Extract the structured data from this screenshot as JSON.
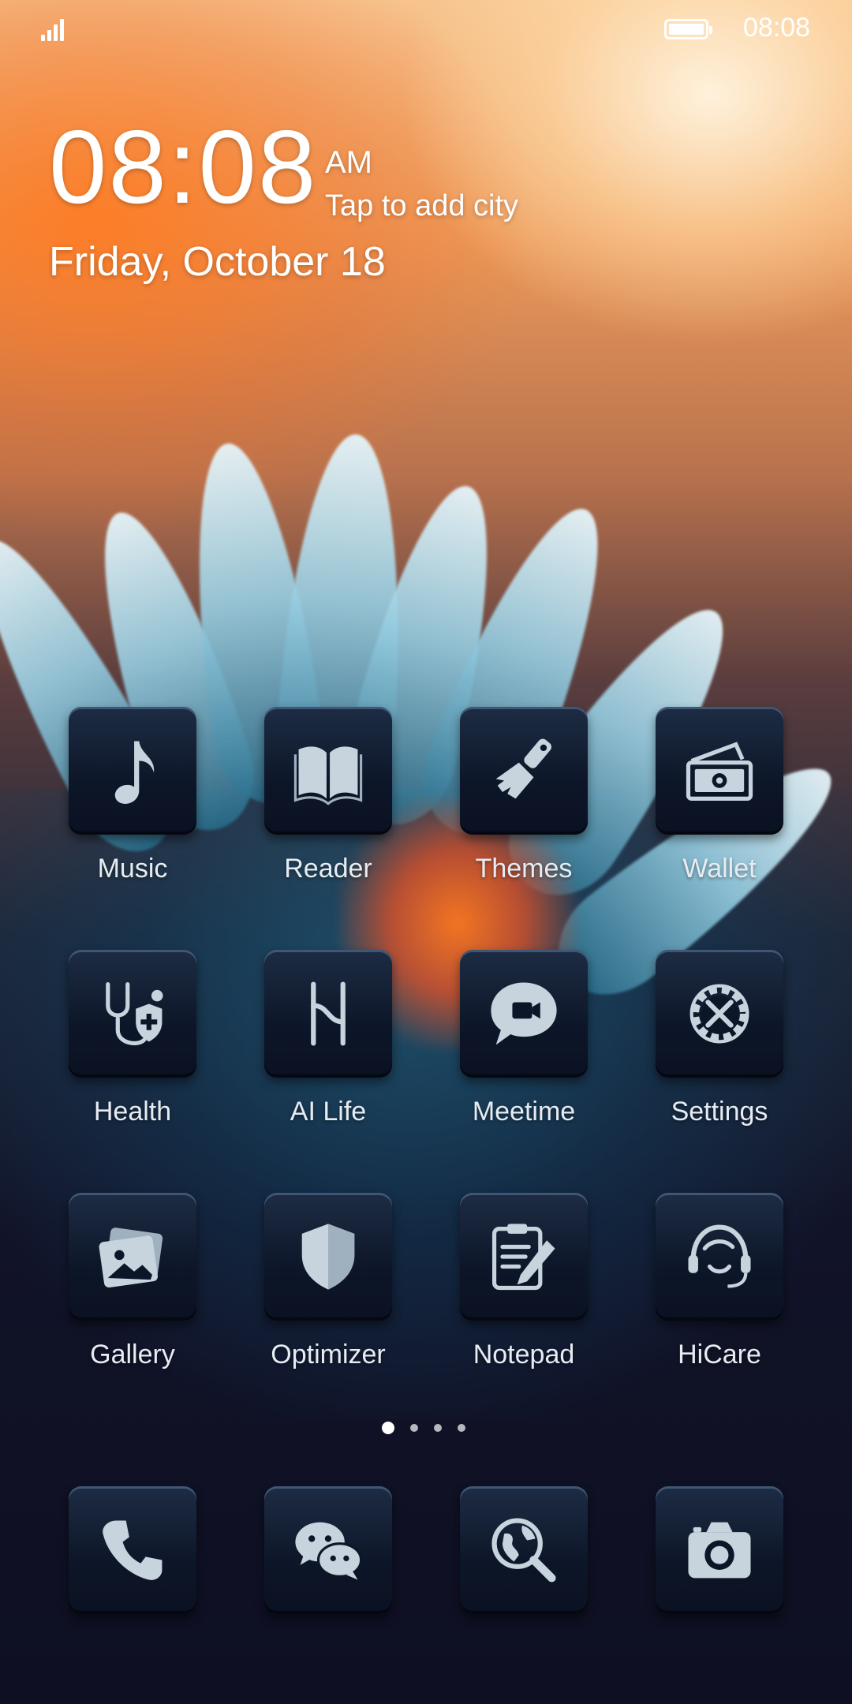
{
  "status_bar": {
    "time": "08:08",
    "battery_level": 1.0,
    "signal_bars": 4
  },
  "clock": {
    "time": "08:08",
    "ampm": "AM",
    "city_prompt": "Tap to add city",
    "date": "Friday, October 18"
  },
  "apps": [
    {
      "label": "Music",
      "icon": "music-note-icon"
    },
    {
      "label": "Reader",
      "icon": "book-icon"
    },
    {
      "label": "Themes",
      "icon": "paintbrush-icon"
    },
    {
      "label": "Wallet",
      "icon": "wallet-cash-icon"
    },
    {
      "label": "Health",
      "icon": "stethoscope-icon"
    },
    {
      "label": "AI Life",
      "icon": "ai-life-icon"
    },
    {
      "label": "Meetime",
      "icon": "video-chat-icon"
    },
    {
      "label": "Settings",
      "icon": "gear-tools-icon"
    },
    {
      "label": "Gallery",
      "icon": "photos-icon"
    },
    {
      "label": "Optimizer",
      "icon": "shield-icon"
    },
    {
      "label": "Notepad",
      "icon": "clipboard-pencil-icon"
    },
    {
      "label": "HiCare",
      "icon": "headset-icon"
    }
  ],
  "page_indicator": {
    "count": 4,
    "current": 1
  },
  "dock": [
    {
      "icon": "phone-icon"
    },
    {
      "icon": "wechat-icon"
    },
    {
      "icon": "globe-search-icon"
    },
    {
      "icon": "camera-icon"
    }
  ],
  "colors": {
    "icon_glyph": "#c7d3dd",
    "icon_background": "#0d1628",
    "label_text": "#e6ecf2"
  }
}
